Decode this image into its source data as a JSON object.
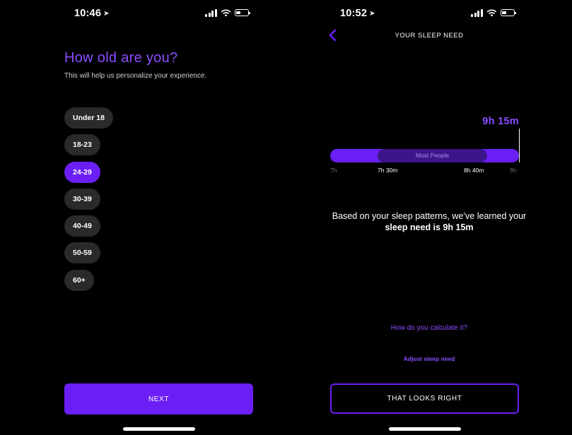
{
  "left_screen": {
    "status_bar": {
      "time": "10:46"
    },
    "title": "How old are you?",
    "subtitle": "This will help us personalize your experience.",
    "age_options": [
      "Under 18",
      "18-23",
      "24-29",
      "30-39",
      "40-49",
      "50-59",
      "60+"
    ],
    "selected_age": "24-29",
    "next_label": "NEXT"
  },
  "right_screen": {
    "status_bar": {
      "time": "10:52"
    },
    "nav_title": "YOUR SLEEP NEED",
    "sleep_need_value": "9h 15m",
    "range": {
      "most_people_label": "Most People",
      "ticks": {
        "min": "7h",
        "low": "7h 30m",
        "high": "8h 40m",
        "max": "9h"
      }
    },
    "explanation_line": "Based on your sleep patterns, we’ve learned your",
    "explanation_bold": "sleep need is 9h 15m",
    "calculate_link": "How do you calculate it?",
    "adjust_link": "Adjust sleep need",
    "confirm_label": "THAT LOOKS RIGHT"
  },
  "colors": {
    "accent": "#6b1ff5",
    "accent_text": "#8b4dff",
    "pill": "#2a2a2a",
    "range_inner": "#3d158a",
    "background": "#000000"
  },
  "icons": [
    "location-arrow-icon",
    "cellular-signal-icon",
    "wifi-icon",
    "battery-icon",
    "chevron-left-icon"
  ]
}
